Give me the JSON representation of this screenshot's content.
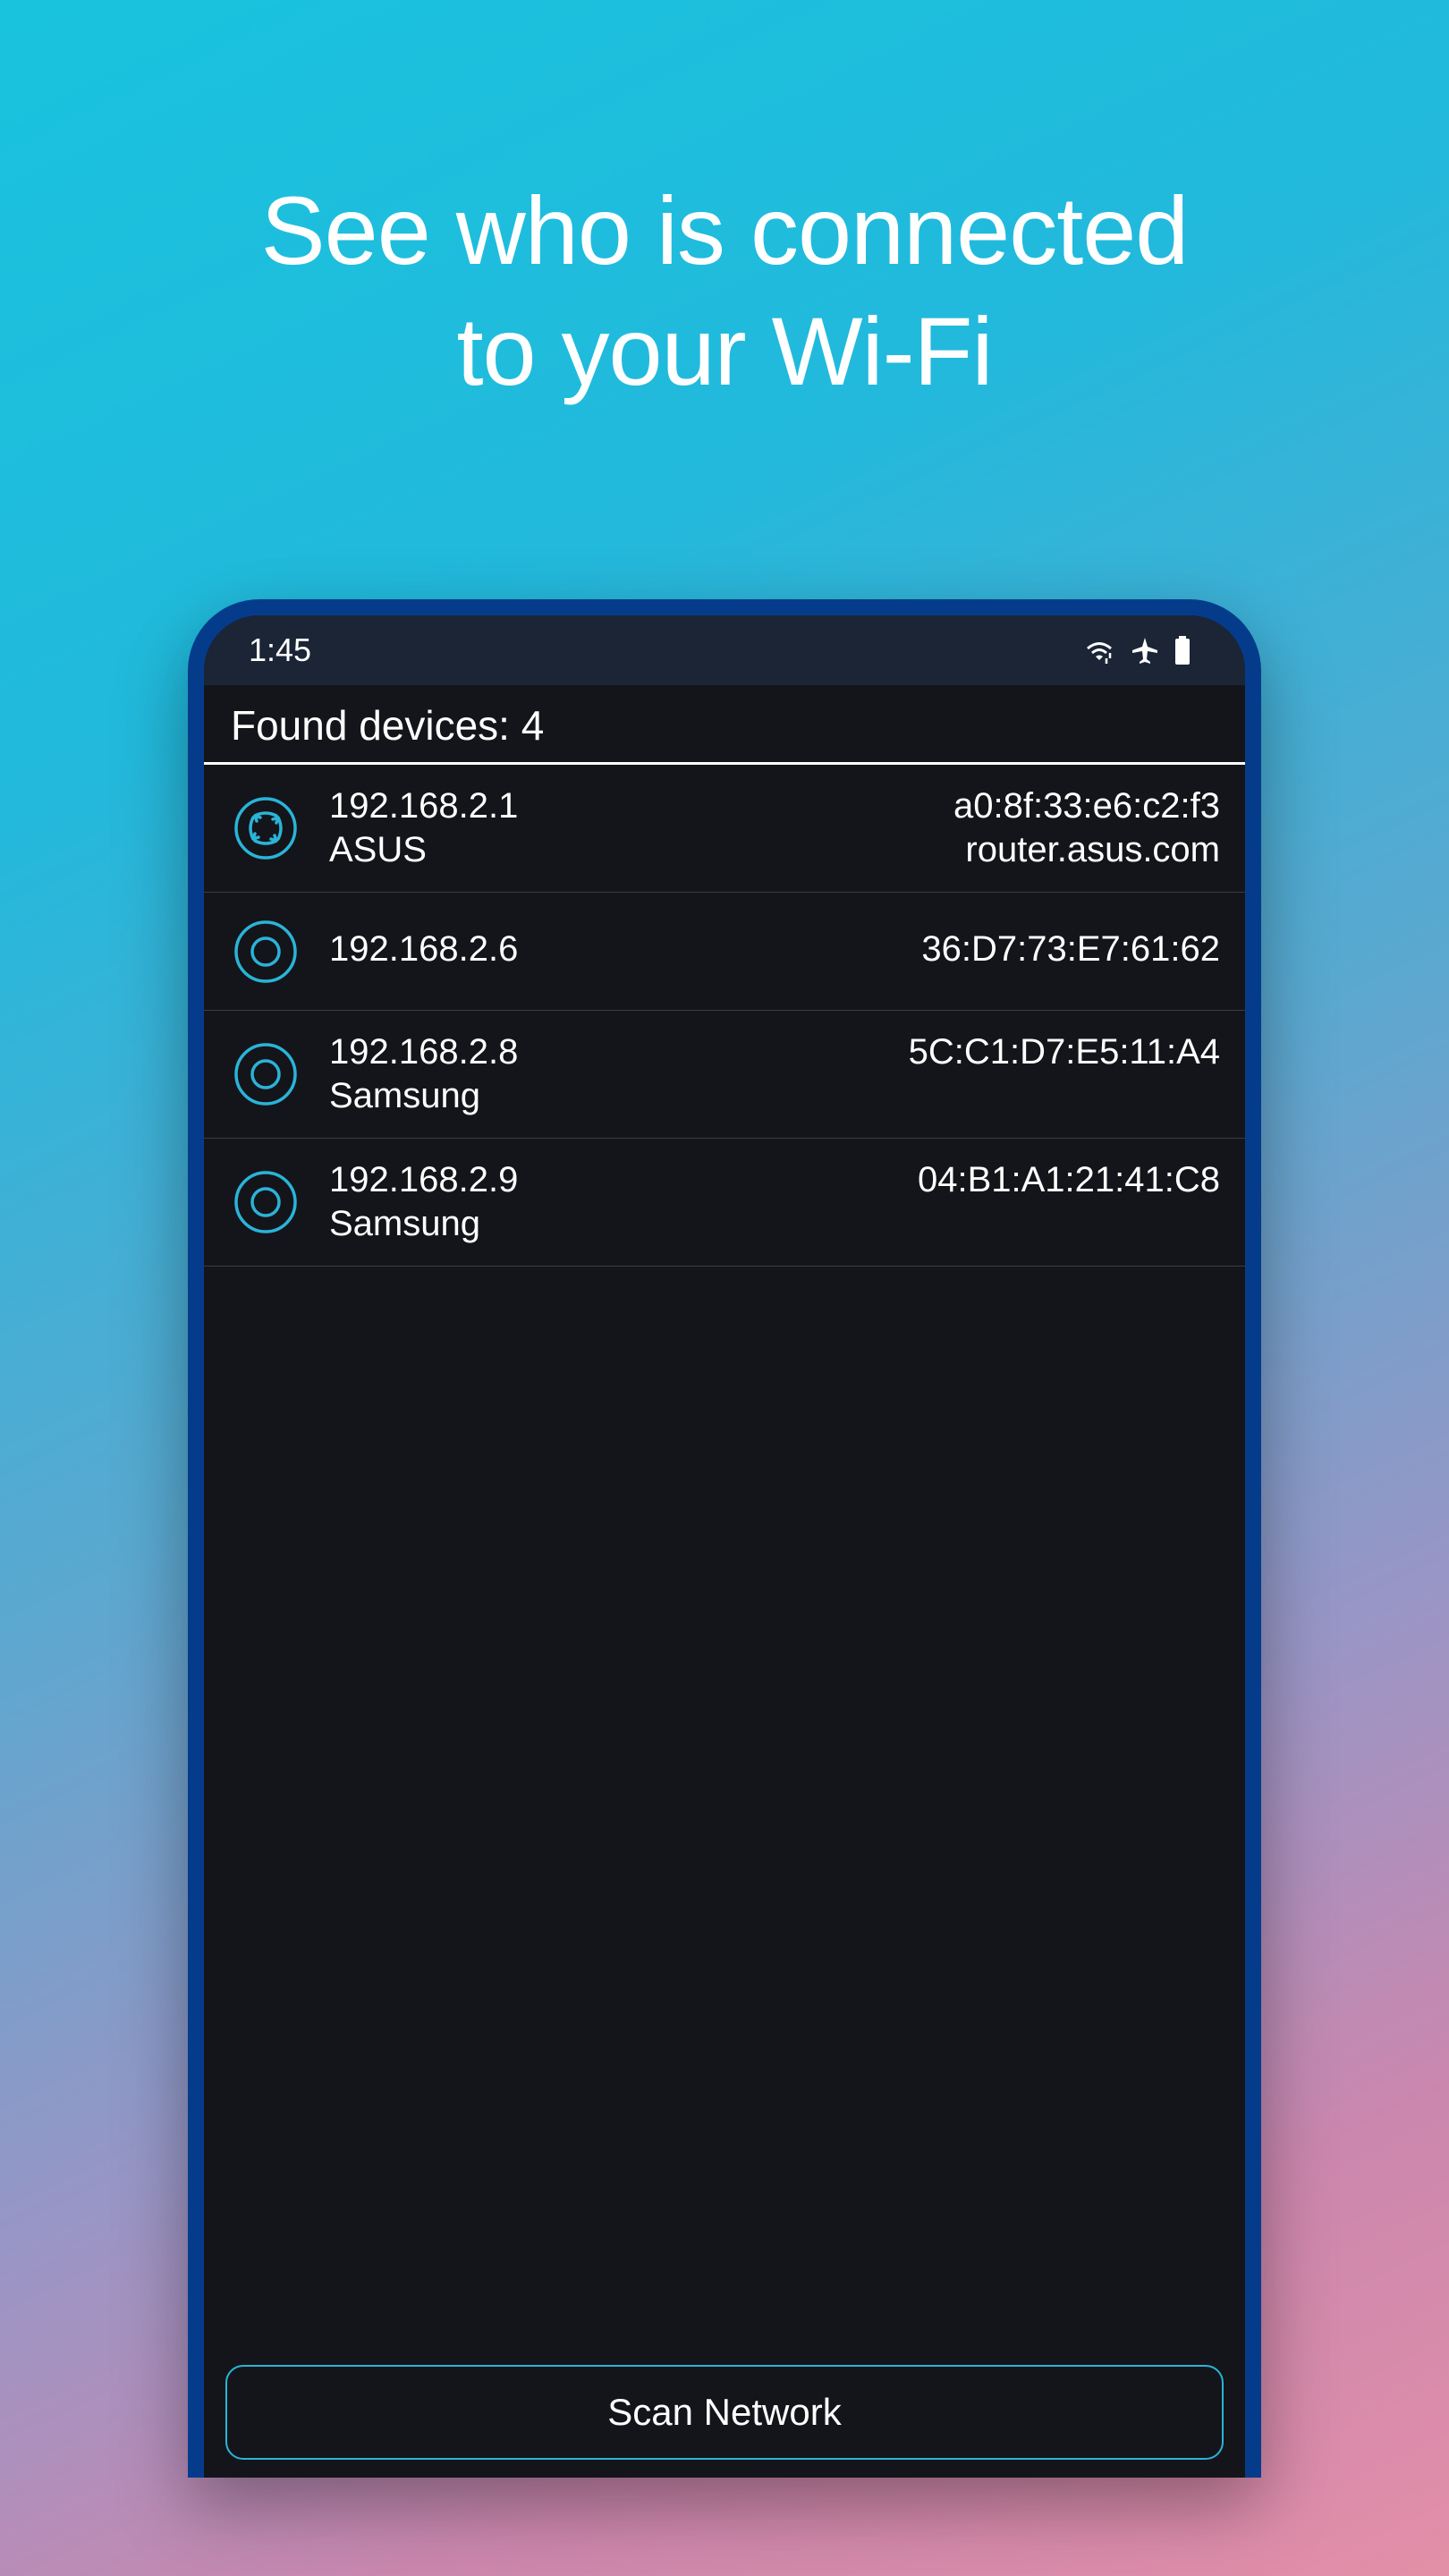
{
  "headline": {
    "line1": "See who is connected",
    "line2": "to your Wi-Fi"
  },
  "status_bar": {
    "time": "1:45"
  },
  "app": {
    "found_devices_label": "Found devices: 4",
    "scan_button_label": "Scan Network",
    "accent_color": "#2bb3d8",
    "devices": [
      {
        "ip": "192.168.2.1",
        "name": "ASUS",
        "mac": "a0:8f:33:e6:c2:f3",
        "hostname": "router.asus.com",
        "icon": "router-icon"
      },
      {
        "ip": "192.168.2.6",
        "name": "",
        "mac": "36:D7:73:E7:61:62",
        "hostname": "",
        "icon": "device-icon"
      },
      {
        "ip": "192.168.2.8",
        "name": "Samsung",
        "mac": "5C:C1:D7:E5:11:A4",
        "hostname": "",
        "icon": "device-icon"
      },
      {
        "ip": "192.168.2.9",
        "name": "Samsung",
        "mac": "04:B1:A1:21:41:C8",
        "hostname": "",
        "icon": "device-icon"
      }
    ]
  }
}
